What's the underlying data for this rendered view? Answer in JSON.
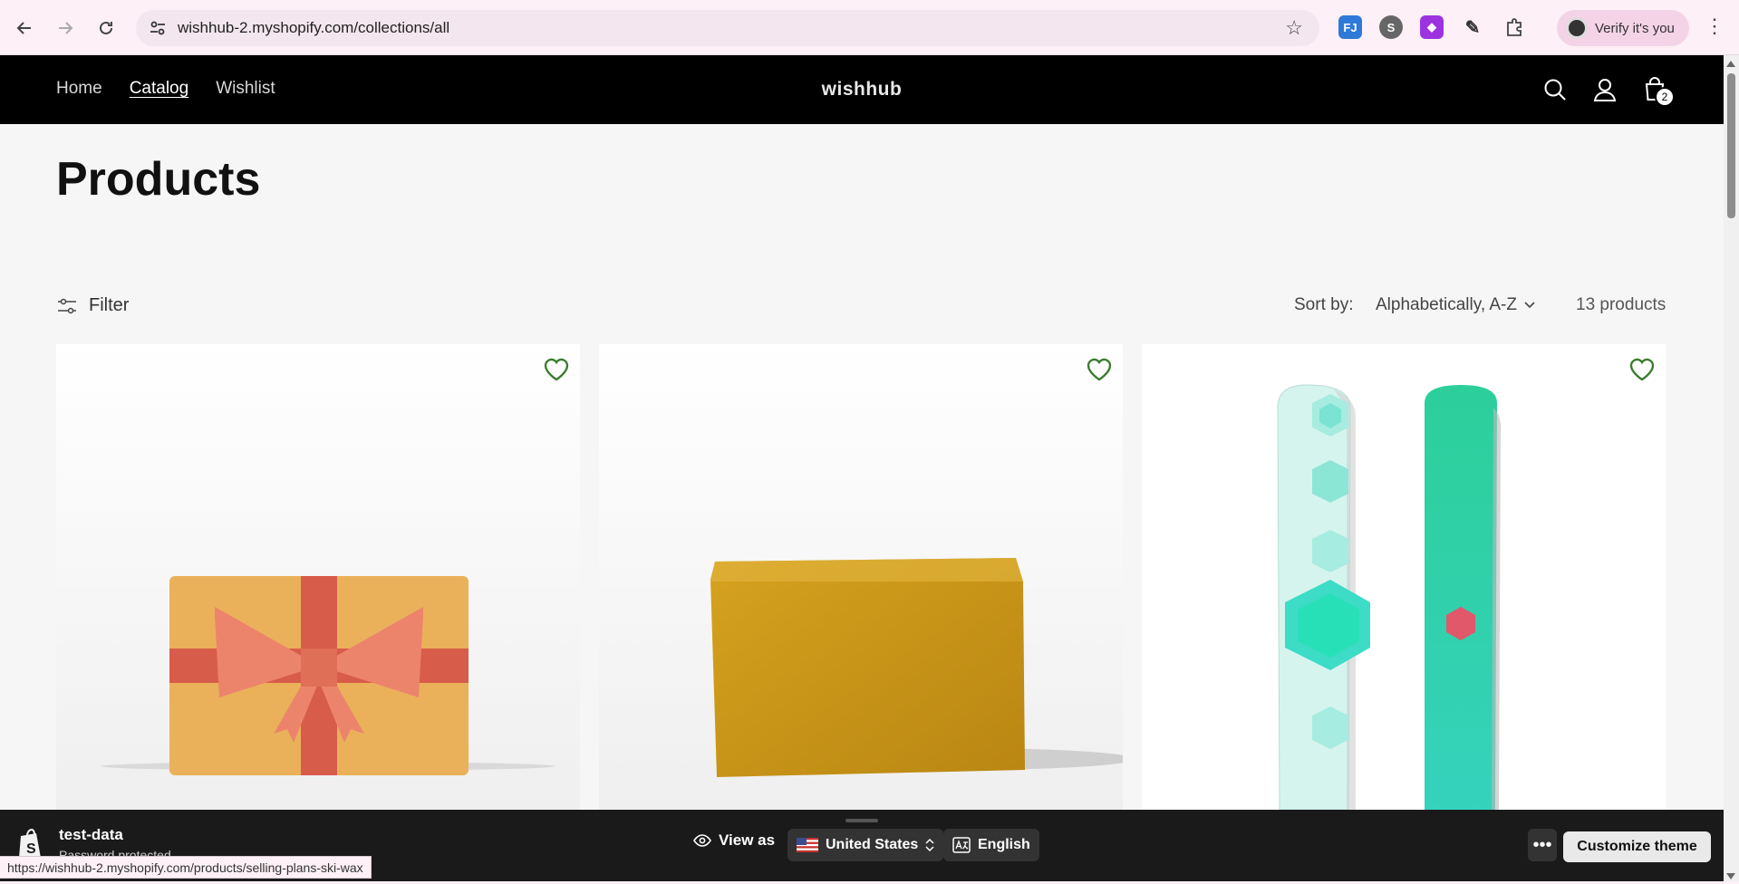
{
  "browser": {
    "url": "wishhub-2.myshopify.com/collections/all",
    "verify_label": "Verify it's you",
    "extensions": [
      "translate-icon",
      "circle-icon",
      "purple-ext-icon",
      "eyedropper-icon",
      "puzzle-icon"
    ],
    "status_url": "https://wishhub-2.myshopify.com/products/selling-plans-ski-wax"
  },
  "store": {
    "brand": "wishhub",
    "nav": [
      {
        "label": "Home",
        "active": false
      },
      {
        "label": "Catalog",
        "active": true
      },
      {
        "label": "Wishlist",
        "active": false
      }
    ],
    "cart_count": "2"
  },
  "collection": {
    "title": "Products",
    "filter_label": "Filter",
    "sort_label": "Sort by:",
    "sort_value": "Alphabetically, A-Z",
    "product_count": "13 products"
  },
  "products": [
    {
      "image": "gift-card-box",
      "wishlist": "heart-outline-icon"
    },
    {
      "image": "ski-wax-bar",
      "wishlist": "heart-outline-icon"
    },
    {
      "image": "snowboard-pair",
      "wishlist": "heart-outline-icon"
    }
  ],
  "preview_bar": {
    "store_name": "test-data",
    "store_sub": "Password protected",
    "view_as": "View as",
    "country": "United States",
    "language": "English",
    "customize_label": "Customize theme"
  },
  "colors": {
    "header_bg": "#000000",
    "page_bg": "#f6f6f6",
    "heart": "#3b7d2f",
    "chrome_bg": "#fdf0f6"
  }
}
